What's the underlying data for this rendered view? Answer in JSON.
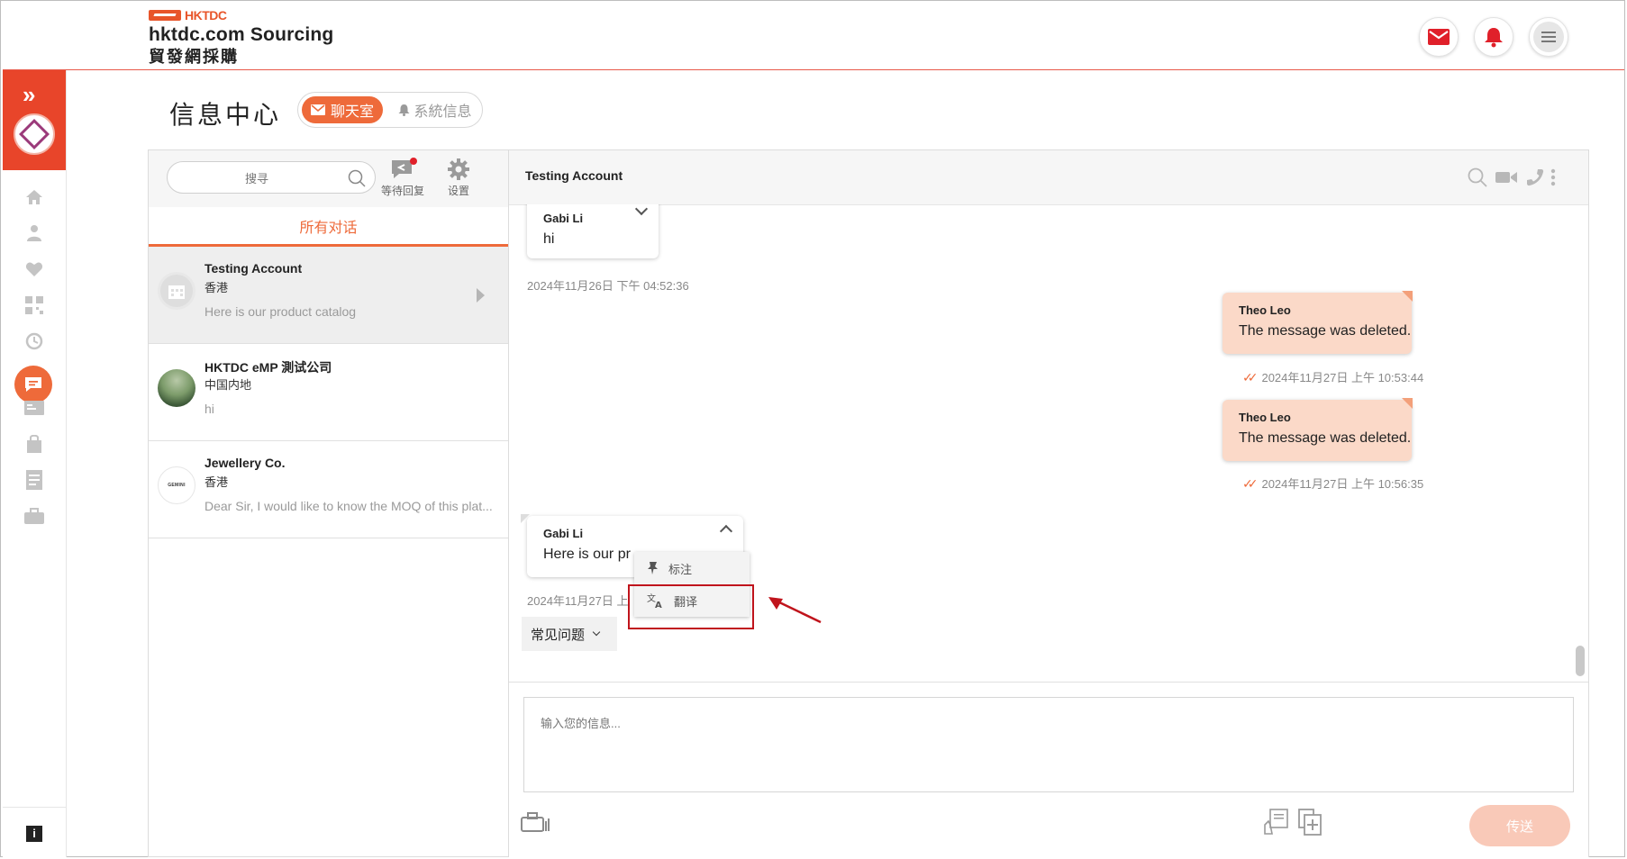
{
  "header": {
    "logo_mark": "HKTDC",
    "logo_title": "hktdc.com Sourcing",
    "logo_subtitle": "貿發網採購",
    "icons": [
      "mail-icon",
      "bell-icon",
      "menu-icon"
    ]
  },
  "page": {
    "title": "信息中心",
    "tabs": [
      {
        "label": "聊天室",
        "active": true
      },
      {
        "label": "系統信息",
        "active": false
      }
    ]
  },
  "sidebar": {
    "icons": [
      "home-icon",
      "user-icon",
      "heart-icon",
      "qr-code-icon",
      "history-icon",
      "chat-icon",
      "id-card-icon",
      "bag-icon",
      "document-icon",
      "briefcase-icon"
    ],
    "info_label": "i"
  },
  "conversations": {
    "search_placeholder": "搜寻",
    "pending_label": "等待回复",
    "settings_label": "设置",
    "filter_tab": "所有对话",
    "items": [
      {
        "name": "Testing Account",
        "location": "香港",
        "preview": "Here is our product catalog",
        "selected": true
      },
      {
        "name": "HKTDC eMP 測试公司",
        "location": "中国内地",
        "preview": "hi",
        "selected": false
      },
      {
        "name": "Jewellery Co.",
        "location": "香港",
        "preview": "Dear Sir, I would like to know the MOQ of this plat...",
        "selected": false,
        "avatar_text": "GEMINI"
      }
    ]
  },
  "chat": {
    "title": "Testing Account",
    "messages": [
      {
        "sender": "Gabi Li",
        "text": "hi",
        "time": "2024年11月26日 下午 04:52:36",
        "direction": "in"
      },
      {
        "sender": "Theo Leo",
        "text": "The message was deleted.",
        "time": "2024年11月27日 上午 10:53:44",
        "direction": "out"
      },
      {
        "sender": "Theo Leo",
        "text": "The message was deleted.",
        "time": "2024年11月27日 上午 10:56:35",
        "direction": "out"
      },
      {
        "sender": "Gabi Li",
        "text": "Here is our pr",
        "time": "2024年11月27日 上",
        "direction": "in"
      }
    ],
    "context_menu": [
      "标注",
      "翻译"
    ],
    "faq_label": "常见问题",
    "input_placeholder": "输入您的信息...",
    "send_label": "传送"
  },
  "colors": {
    "accent": "#ee6a3a",
    "brand": "#e8452a",
    "outgoing_bubble": "#fbd9c8",
    "highlight": "#c0141c"
  }
}
